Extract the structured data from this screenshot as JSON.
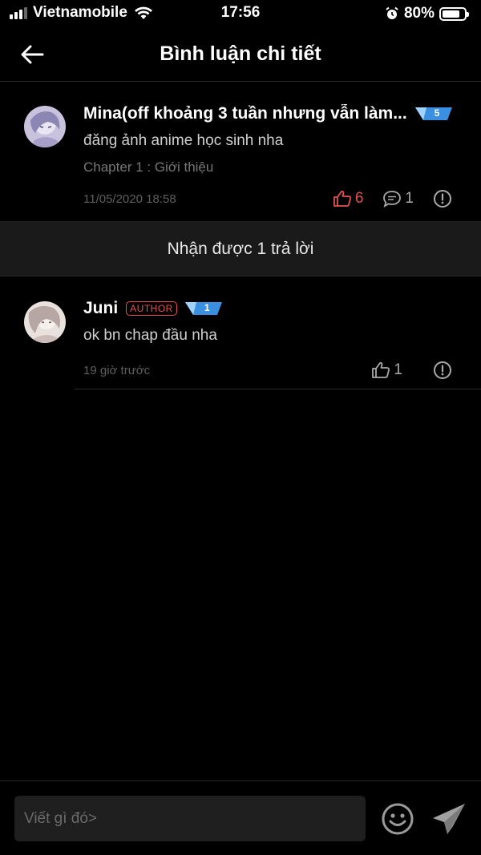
{
  "status_bar": {
    "carrier": "Vietnamobile",
    "time": "17:56",
    "battery_percent": "80%",
    "battery_level": 0.8,
    "icons": [
      "signal-icon",
      "wifi-icon",
      "alarm-icon",
      "battery-icon"
    ]
  },
  "header": {
    "title": "Bình luận chi tiết",
    "back_icon": "arrow-left-icon"
  },
  "comment": {
    "name": "Mina(off khoảng 3 tuần nhưng vẫn làm...",
    "level": "5",
    "text": "đăng ảnh anime học sinh nha",
    "chapter": "Chapter 1 : Giới thiệu",
    "time": "11/05/2020 18:58",
    "likes": "6",
    "replies": "1",
    "liked": true
  },
  "reply_banner": "Nhận được 1 trả lời",
  "reply": {
    "name": "Juni",
    "author_tag": "AUTHOR",
    "level": "1",
    "text": "ok bn chap đầu nha",
    "time": "19 giờ trước",
    "likes": "1"
  },
  "composer": {
    "placeholder": "Viết gì đó>"
  },
  "colors": {
    "background": "#000000",
    "accent_red": "#e5514f",
    "badge_blue": "#3b8fe0"
  }
}
